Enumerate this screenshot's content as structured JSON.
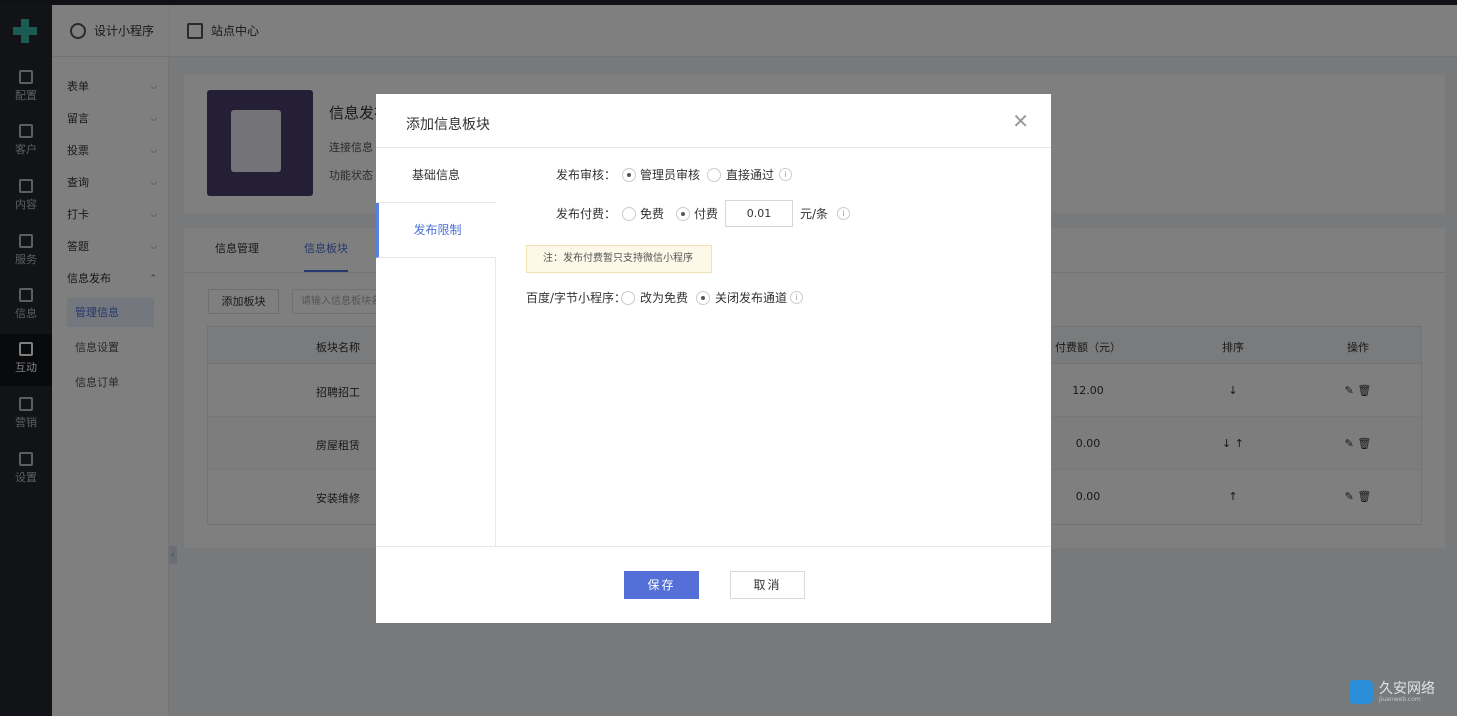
{
  "rail": {
    "items": [
      {
        "label": "配置",
        "icon": "config-icon"
      },
      {
        "label": "客户",
        "icon": "customer-icon"
      },
      {
        "label": "内容",
        "icon": "content-icon"
      },
      {
        "label": "服务",
        "icon": "service-icon"
      },
      {
        "label": "信息",
        "icon": "message-icon"
      },
      {
        "label": "互动",
        "icon": "gamepad-icon"
      },
      {
        "label": "营销",
        "icon": "tag-icon"
      },
      {
        "label": "设置",
        "icon": "gear-icon"
      }
    ]
  },
  "topbar": {
    "design": "设计小程序",
    "site": "站点中心"
  },
  "submenu": {
    "groups": [
      "表单",
      "留言",
      "投票",
      "查询",
      "打卡",
      "答题",
      "信息发布"
    ],
    "subitems": [
      "管理信息",
      "信息设置",
      "信息订单"
    ]
  },
  "header": {
    "title": "信息发布",
    "line1": "连接信息",
    "line2": "功能状态"
  },
  "tabs": [
    "信息管理",
    "信息板块"
  ],
  "toolbar": {
    "add_label": "添加板块",
    "search_placeholder": "请输入信息板块名"
  },
  "table": {
    "columns": [
      "板块名称",
      "付费额（元）",
      "排序",
      "操作"
    ],
    "rows": [
      {
        "name": "招聘招工",
        "fee": "12.00",
        "sort": "↓"
      },
      {
        "name": "房屋租赁",
        "fee": "0.00",
        "sort": "↓ ↑"
      },
      {
        "name": "安装维修",
        "fee": "0.00",
        "sort": "↑"
      }
    ]
  },
  "modal": {
    "title": "添加信息板块",
    "side": [
      "基础信息",
      "发布限制"
    ],
    "review": {
      "label": "发布审核：",
      "opt1": "管理员审核",
      "opt2": "直接通过"
    },
    "fee": {
      "label": "发布付费：",
      "opt1": "免费",
      "opt2": "付费",
      "value": "0.01",
      "unit": "元/条"
    },
    "note": "注：发布付费暂只支持微信小程序",
    "baidu": {
      "label": "百度/字节小程序：",
      "opt1": "改为免费",
      "opt2": "关闭发布通道"
    },
    "save": "保存",
    "cancel": "取消"
  },
  "watermark": {
    "text": "久安网络",
    "sub": "jiuanweb.com"
  },
  "colors": {
    "accent": "#5470d8",
    "rail": "#22262e"
  }
}
